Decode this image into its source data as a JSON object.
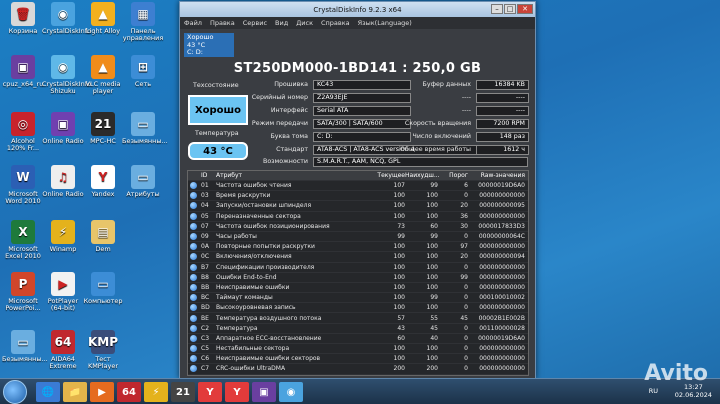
{
  "desktop": {
    "icons": [
      {
        "label": "Корзина",
        "color": "#d8d8d8",
        "glyph": "🗑"
      },
      {
        "label": "CrystalDiskInfo",
        "color": "#4aa3df",
        "glyph": "◉"
      },
      {
        "label": "Light Alloy",
        "color": "#f2b01e",
        "glyph": "▲"
      },
      {
        "label": "Панель управления",
        "color": "#3d7fd1",
        "glyph": "▦"
      },
      {
        "label": "cpuz_x64_ru",
        "color": "#6a3fa0",
        "glyph": "▣"
      },
      {
        "label": "CrystalDiskInfo Shizuku",
        "color": "#5fb8e8",
        "glyph": "◉"
      },
      {
        "label": "VLC media player",
        "color": "#f08c1a",
        "glyph": "▲"
      },
      {
        "label": "Сеть",
        "color": "#3c8dd6",
        "glyph": "⊞"
      },
      {
        "label": "Alcohol 120% Fr...",
        "color": "#c8232c",
        "glyph": "◎"
      },
      {
        "label": "Online Radio",
        "color": "#7040b0",
        "glyph": "▣"
      },
      {
        "label": "MPC-HC",
        "color": "#2b2b2b",
        "glyph": "21"
      },
      {
        "label": "Безымянны...",
        "color": "#6aaee0",
        "glyph": "▭"
      },
      {
        "label": "Microsoft Word 2010",
        "color": "#2b5fb4",
        "glyph": "W"
      },
      {
        "label": "Online Radio",
        "color": "#eeeeee",
        "glyph": "♫"
      },
      {
        "label": "Yandex",
        "color": "#ffffff",
        "glyph": "Y"
      },
      {
        "label": "Атрибуты",
        "color": "#6aaee0",
        "glyph": "▭"
      },
      {
        "label": "Microsoft Excel 2010",
        "color": "#1e7a3c",
        "glyph": "X"
      },
      {
        "label": "Winamp",
        "color": "#e4b21c",
        "glyph": "⚡"
      },
      {
        "label": "Dem",
        "color": "#e8c56a",
        "glyph": "▤"
      },
      {
        "label": "",
        "color": "transparent",
        "glyph": ""
      },
      {
        "label": "Microsoft PowerPoi...",
        "color": "#d0462b",
        "glyph": "P"
      },
      {
        "label": "PotPlayer (64-bit)",
        "color": "#f2f2f2",
        "glyph": "▶"
      },
      {
        "label": "Компьютер",
        "color": "#3c8dd6",
        "glyph": "▭"
      },
      {
        "label": "",
        "color": "transparent",
        "glyph": ""
      },
      {
        "label": "Безымянны...",
        "color": "#6aaee0",
        "glyph": "▭"
      },
      {
        "label": "AIDA64 Extreme",
        "color": "#c0282e",
        "glyph": "64"
      },
      {
        "label": "Тест KMPlayer",
        "color": "#3a4d7a",
        "glyph": "KMP"
      },
      {
        "label": "",
        "color": "transparent",
        "glyph": ""
      }
    ]
  },
  "window": {
    "title": "CrystalDiskInfo 9.2.3 x64",
    "menu": [
      "Файл",
      "Правка",
      "Сервис",
      "Вид",
      "Диск",
      "Справка",
      "Язык(Language)"
    ],
    "disk_tab": {
      "status": "Хорошо",
      "temp": "43 °C",
      "letter": "C: D:"
    },
    "model": "ST250DM000-1BD141 : 250,0 GB",
    "health_label": "Техсостояние",
    "health": "Хорошо",
    "temp_label": "Температура",
    "temp": "43 °C",
    "info": [
      {
        "label": "Прошивка",
        "value": "KC43"
      },
      {
        "label": "Серийный номер",
        "value": "Z2A93EJE"
      },
      {
        "label": "Интерфейс",
        "value": "Serial ATA"
      },
      {
        "label": "Режим передачи",
        "value": "SATA/300 | SATA/600"
      },
      {
        "label": "Буква тома",
        "value": "C: D:"
      },
      {
        "label": "Стандарт",
        "value": "ATA8-ACS | ATA8-ACS version 4"
      },
      {
        "label": "Возможности",
        "value": "S.M.A.R.T., AAM, NCQ, GPL"
      }
    ],
    "info_right": [
      {
        "label": "Буфер данных",
        "value": "16384 KB"
      },
      {
        "label": "----",
        "value": "----"
      },
      {
        "label": "----",
        "value": "----"
      },
      {
        "label": "Скорость вращения",
        "value": "7200 RPM"
      },
      {
        "label": "Число включений",
        "value": "148 раз"
      },
      {
        "label": "Общее время работы",
        "value": "1612 ч"
      }
    ],
    "columns": [
      "ID",
      "Атрибут",
      "Текущее",
      "Наихудш...",
      "Порог",
      "Raw-значения"
    ],
    "attributes": [
      [
        "01",
        "Частота ошибок чтения",
        "107",
        "99",
        "6",
        "00000019D6A0"
      ],
      [
        "03",
        "Время раскрутки",
        "100",
        "100",
        "0",
        "000000000000"
      ],
      [
        "04",
        "Запуски/остановки шпинделя",
        "100",
        "100",
        "20",
        "000000000095"
      ],
      [
        "05",
        "Переназначенные сектора",
        "100",
        "100",
        "36",
        "000000000000"
      ],
      [
        "07",
        "Частота ошибок позиционирования",
        "73",
        "60",
        "30",
        "0000017833D3"
      ],
      [
        "09",
        "Часы работы",
        "99",
        "99",
        "0",
        "00000000064C"
      ],
      [
        "0A",
        "Повторные попытки раскрутки",
        "100",
        "100",
        "97",
        "000000000000"
      ],
      [
        "0C",
        "Включения/отключения",
        "100",
        "100",
        "20",
        "000000000094"
      ],
      [
        "B7",
        "Спецификации производителя",
        "100",
        "100",
        "0",
        "000000000000"
      ],
      [
        "B8",
        "Ошибки End-to-End",
        "100",
        "100",
        "99",
        "000000000000"
      ],
      [
        "BB",
        "Неисправимые ошибки",
        "100",
        "100",
        "0",
        "000000000000"
      ],
      [
        "BC",
        "Таймаут команды",
        "100",
        "99",
        "0",
        "000100010002"
      ],
      [
        "BD",
        "Высокоуровневая запись",
        "100",
        "100",
        "0",
        "000000000000"
      ],
      [
        "BE",
        "Температура воздушного потока",
        "57",
        "55",
        "45",
        "00002B1E002B"
      ],
      [
        "C2",
        "Температура",
        "43",
        "45",
        "0",
        "001100000028"
      ],
      [
        "C3",
        "Аппаратное ECC-восстановление",
        "60",
        "40",
        "0",
        "00000019D6A0"
      ],
      [
        "C5",
        "Нестабильные сектора",
        "100",
        "100",
        "0",
        "000000000000"
      ],
      [
        "C6",
        "Неисправимые ошибки секторов",
        "100",
        "100",
        "0",
        "000000000000"
      ],
      [
        "C7",
        "CRC-ошибки UltraDMA",
        "200",
        "200",
        "0",
        "000000000000"
      ]
    ]
  },
  "taskbar": {
    "items": [
      "🌐",
      "📁",
      "▶",
      "64",
      "⚡",
      "21",
      "Y",
      "Y",
      "▣",
      "◉"
    ],
    "time": "13:27",
    "date": "02.06.2024",
    "lang": "RU"
  },
  "watermark": "Avito"
}
